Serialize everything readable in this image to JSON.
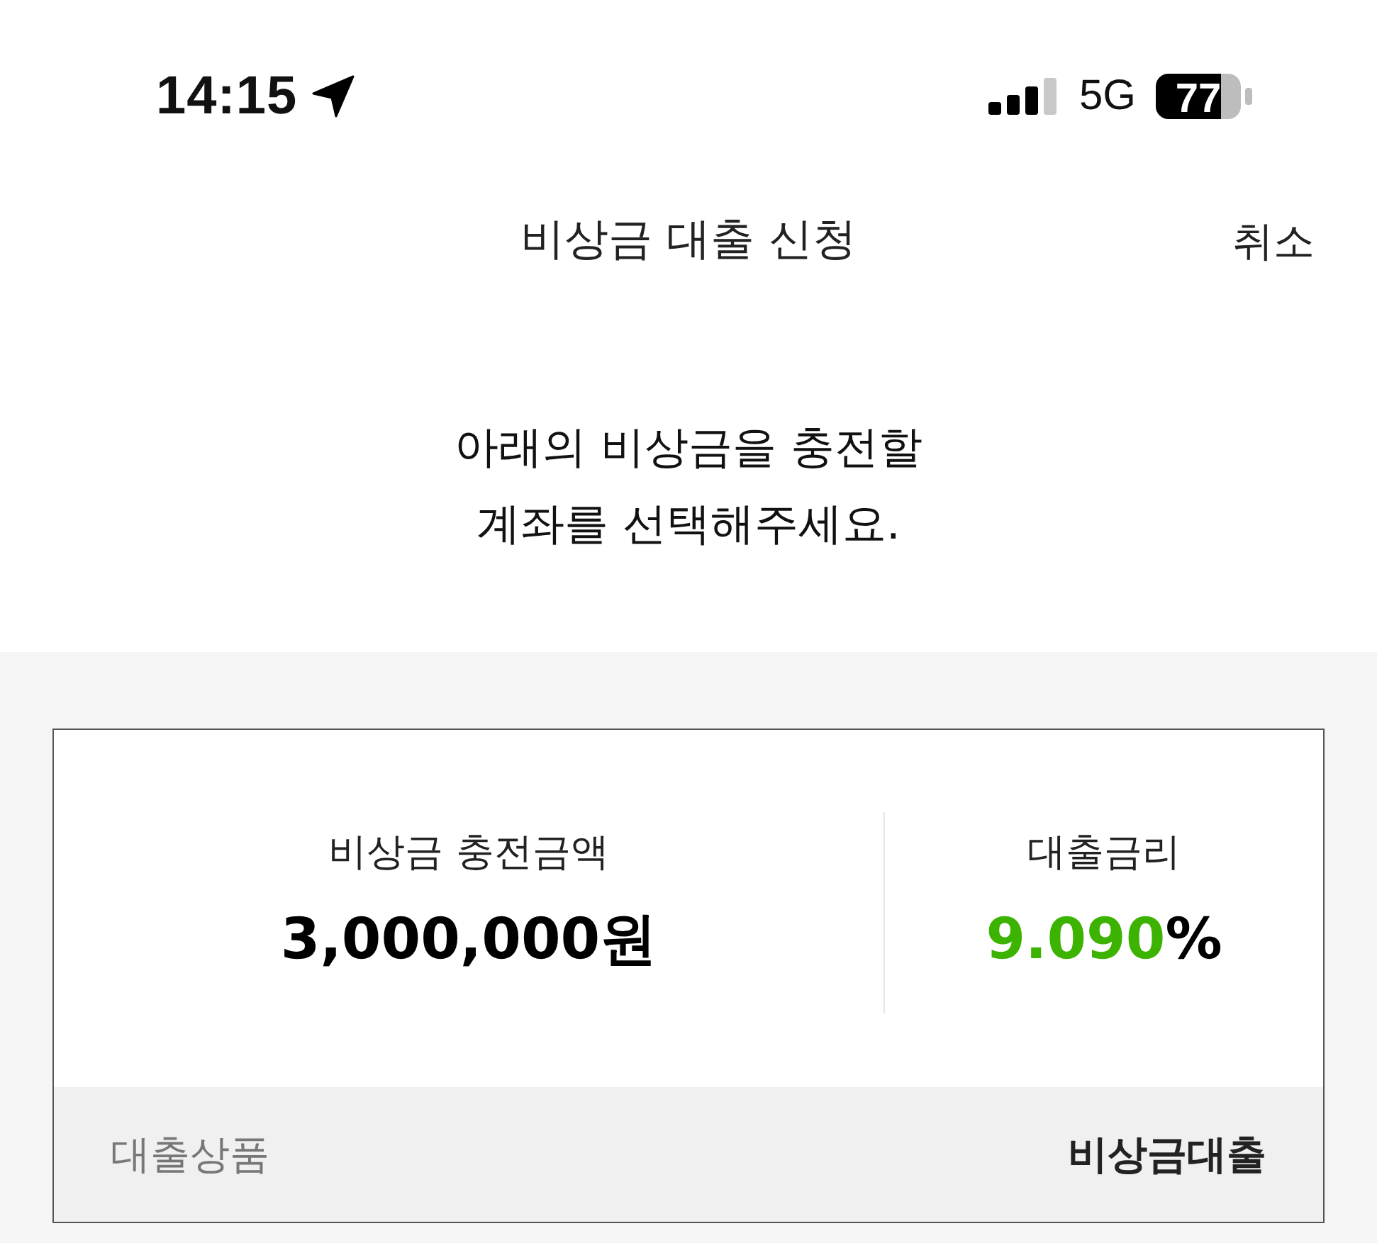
{
  "status_bar": {
    "time": "14:15",
    "network": "5G",
    "battery": "77"
  },
  "header": {
    "title": "비상금 대출 신청",
    "cancel": "취소"
  },
  "message": "아래의 비상금을 충전할\n계좌를 선택해주세요.",
  "summary": {
    "items": [
      {
        "kind": "amount",
        "label": "비상금 충전금액",
        "value": "3,000,000원"
      },
      {
        "kind": "rate",
        "label": "대출금리",
        "value": "9.090",
        "unit": "%",
        "color": "#3cb300"
      }
    ],
    "product": {
      "label": "대출상품",
      "value": "비상금대출"
    }
  }
}
